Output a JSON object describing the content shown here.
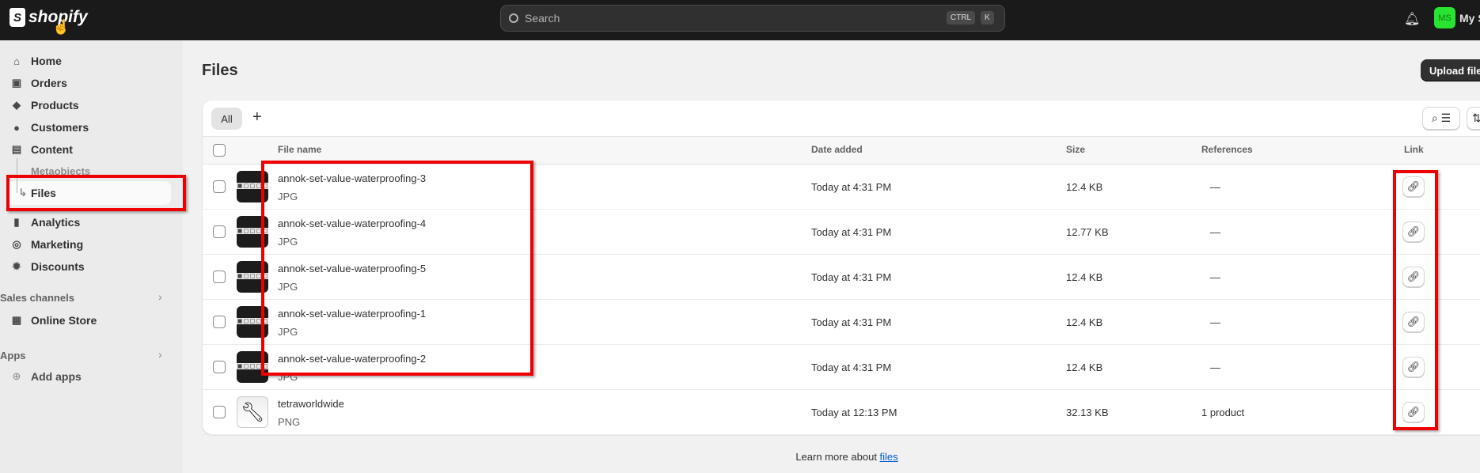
{
  "topbar": {
    "logo": "shopify",
    "search_placeholder": "Search",
    "shortcut_ctrl": "CTRL",
    "shortcut_k": "K",
    "avatar_initials": "MS",
    "store_name": "My S"
  },
  "sidebar": {
    "items": [
      {
        "label": "Home",
        "icon": "home-icon"
      },
      {
        "label": "Orders",
        "icon": "inbox-icon"
      },
      {
        "label": "Products",
        "icon": "tag-icon"
      },
      {
        "label": "Customers",
        "icon": "person-icon"
      },
      {
        "label": "Content",
        "icon": "image-icon"
      },
      {
        "label": "Metaobjects"
      },
      {
        "label": "Files"
      },
      {
        "label": "Analytics",
        "icon": "chart-icon"
      },
      {
        "label": "Marketing",
        "icon": "target-icon"
      },
      {
        "label": "Discounts",
        "icon": "discount-icon"
      }
    ],
    "sales_channels": "Sales channels",
    "online_store": "Online Store",
    "apps": "Apps",
    "add_apps": "Add apps"
  },
  "page": {
    "title": "Files",
    "upload_label": "Upload files",
    "tab_all": "All",
    "tab_add": "+"
  },
  "table": {
    "headers": {
      "file_name": "File name",
      "date_added": "Date added",
      "size": "Size",
      "references": "References",
      "link": "Link"
    },
    "rows": [
      {
        "name": "annok-set-value-waterproofing-3",
        "type": "JPG",
        "date": "Today at 4:31 PM",
        "size": "12.4 KB",
        "refs": "—"
      },
      {
        "name": "annok-set-value-waterproofing-4",
        "type": "JPG",
        "date": "Today at 4:31 PM",
        "size": "12.77 KB",
        "refs": "—"
      },
      {
        "name": "annok-set-value-waterproofing-5",
        "type": "JPG",
        "date": "Today at 4:31 PM",
        "size": "12.4 KB",
        "refs": "—"
      },
      {
        "name": "annok-set-value-waterproofing-1",
        "type": "JPG",
        "date": "Today at 4:31 PM",
        "size": "12.4 KB",
        "refs": "—"
      },
      {
        "name": "annok-set-value-waterproofing-2",
        "type": "JPG",
        "date": "Today at 4:31 PM",
        "size": "12.4 KB",
        "refs": "—"
      },
      {
        "name": "tetraworldwide",
        "type": "PNG",
        "date": "Today at 12:13 PM",
        "size": "32.13 KB",
        "refs": "1 product"
      }
    ]
  },
  "footer": {
    "text": "Learn more about ",
    "link": "files"
  }
}
